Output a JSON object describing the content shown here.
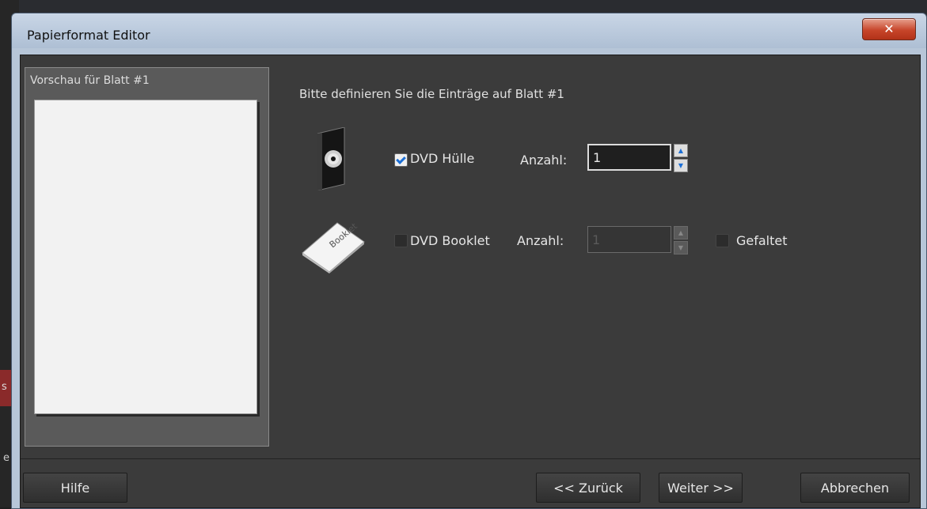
{
  "window": {
    "title": "Papierformat Editor",
    "close_label": "✕"
  },
  "preview": {
    "label": "Vorschau für Blatt #1"
  },
  "instruction": "Bitte definieren Sie die Einträge auf Blatt #1",
  "rows": {
    "dvd_case": {
      "icon": "dvd-case-icon",
      "checked": true,
      "label": "DVD Hülle",
      "count_label": "Anzahl:",
      "count_value": "1"
    },
    "dvd_booklet": {
      "icon": "booklet-icon",
      "checked": false,
      "label": "DVD Booklet",
      "count_label": "Anzahl:",
      "count_value": "1",
      "folded_label": "Gefaltet"
    }
  },
  "buttons": {
    "help": "Hilfe",
    "back": "<< Zurück",
    "next": "Weiter >>",
    "cancel": "Abbrechen"
  },
  "colors": {
    "accent": "#1c6fd6",
    "close": "#c7452a"
  }
}
